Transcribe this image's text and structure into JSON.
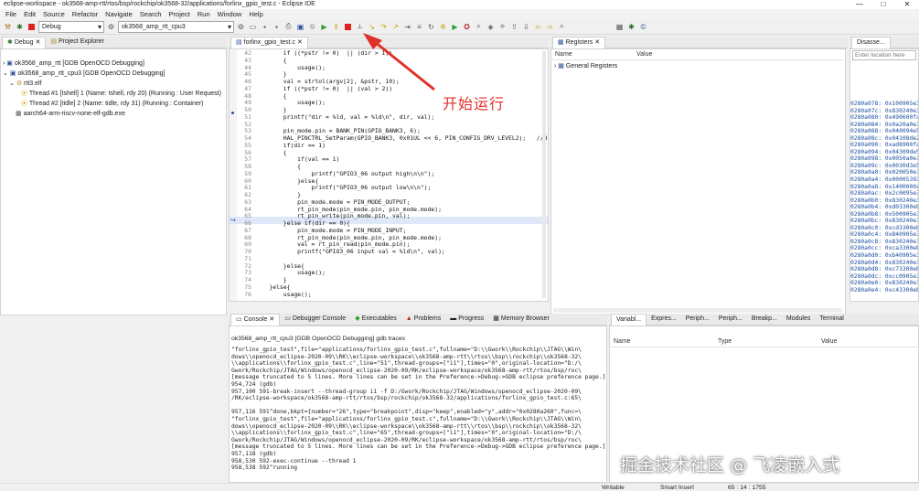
{
  "window": {
    "title": "eclipse-workspace - ok3568-amp-rtt/rtos/bsp/rockchip/ok3568-32/applications/forlinx_gpio_test.c - Eclipse IDE",
    "min": "—",
    "max": "□",
    "close": "✕"
  },
  "menu": [
    "File",
    "Edit",
    "Source",
    "Refactor",
    "Navigate",
    "Search",
    "Project",
    "Run",
    "Window",
    "Help"
  ],
  "toolbar": {
    "launch_mode": "Debug",
    "launch_config": "ok3568_amp_rtt_cpu3"
  },
  "debug_view": {
    "tabs": [
      "Debug",
      "Project Explorer"
    ],
    "tree": [
      "ok3568_amp_rtt [GDB OpenOCD Debugging]",
      "ok3568_amp_rtt_cpu3 [GDB OpenOCD Debugging]",
      "rtt3.elf",
      "Thread #1 [tshell] 1 (Name: tshell, rdy 20) (Running : User Request)",
      "Thread #2 [tidle] 2 (Name: tidle, rdy 31) (Running : Container)",
      "aarch64-arm-riscv-none-elf-gdb.exe"
    ]
  },
  "editor": {
    "tab": "forlinx_gpio_test.c",
    "line_numbers": [
      "42",
      "43",
      "44",
      "45",
      "46",
      "47",
      "48",
      "49",
      "50",
      "51",
      "52",
      "53",
      "54",
      "55",
      "56",
      "57",
      "58",
      "59",
      "60",
      "61",
      "62",
      "63",
      "64",
      "65",
      "66",
      "67",
      "68",
      "69",
      "70",
      "71",
      "72",
      "73",
      "74",
      "75",
      "76"
    ],
    "lines": [
      "        if ((*pstr != 0)  || (dir > 1))",
      "        {",
      "            usage();",
      "        }",
      "        val = strtol(argv[2], &pstr, 10);",
      "        if ((*pstr != 0)  || (val > 2))",
      "        {",
      "            usage();",
      "        }",
      "        printf(\"dir = %ld, val = %ld\\n\", dir, val);",
      "",
      "        pin_mode.pin = BANK_PIN(GPIO_BANK3, 6);",
      "        HAL_PINCTRL_SetParam(GPIO_BANK3, 0x01UL << 6, PIN_CONFIG_DRV_LEVEL2);   //d",
      "        if(dir == 1)",
      "        {",
      "            if(val == 1)",
      "            {",
      "                printf(\"GPIO3_06 output high\\n\\n\");",
      "            }else{",
      "                printf(\"GPIO3_06 output low\\n\\n\");",
      "            }",
      "            pin_mode.mode = PIN_MODE_OUTPUT;",
      "            rt_pin_mode(pin_mode.pin, pin_mode.mode);",
      "            rt_pin_write(pin_mode.pin, val);",
      "        }else if(dir == 0){",
      "            pin_mode.mode = PIN_MODE_INPUT;",
      "            rt_pin_mode(pin_mode.pin, pin_mode.mode);",
      "            val = rt_pin_read(pin_mode.pin);",
      "            printf(\"GPIO3_06 input val = %ld\\n\", val);",
      "",
      "        }else{",
      "            usage();",
      "        }",
      "    }else{",
      "        usage();"
    ]
  },
  "registers": {
    "tabs": [
      "Registers"
    ],
    "col_name": "Name",
    "col_value": "Value",
    "row": "General Registers"
  },
  "disassembly": {
    "tab": "Disasse...",
    "placeholder": "Enter location here",
    "lines": [
      "0280a078: 0x100905e3",
      "0280a07c: 0x830240e3",
      "0280a080: 0x490600fa",
      "0280a084: 0x0a20a0e3",
      "0280a088: 0x040094e5",
      "0280a08c: 0x04108de2",
      "0280a090: 0xad8900fa",
      "0280a094: 0x04309de5",
      "0280a098: 0x0050a0e1",
      "0280a09c: 0x0030d3e5",
      "0280a0a0: 0x020050e3",
      "0280a0a4: 0x00005393",
      "0280a0a8: 0x1400000a",
      "0280a0ac: 0x2c0095e3",
      "0280a0b0: 0x830240e3",
      "0280a0b4: 0xd03300eb",
      "0280a0b8: 0x500905e3",
      "0280a0bc: 0x830240e3",
      "0280a0c0: 0xcd3300eb",
      "0280a0c4: 0x840905e3",
      "0280a0c8: 0x830240e3",
      "0280a0cc: 0xca3300eb",
      "0280a0d0: 0xb40905e3",
      "0280a0d4: 0x830240e3",
      "0280a0d8: 0xc73300eb",
      "0280a0dc: 0xcc0905e3",
      "0280a0e0: 0x830240e3",
      "0280a0e4: 0xc43300eb"
    ]
  },
  "console": {
    "tabs": [
      "Console",
      "Debugger Console",
      "Executables",
      "Problems",
      "Progress",
      "Memory Browser"
    ],
    "header": "ok3568_amp_rtt_cpu3 [GDB OpenOCD Debugging] gdb traces",
    "lines": [
      "\"forlinx_gpio_test\",file=\"applications/forlinx_gpio_test.c\",fullname=\"D:\\\\Gwork\\\\Rockchip\\\\JTAG\\\\Win\\",
      "dows\\\\openocd_eclipse-2020-09\\\\RK\\\\eclipse-workspace\\\\ok3568-amp-rtt\\\\rtos\\\\bsp\\\\rockchip\\\\ok3568-32\\",
      "\\\\applications\\\\forlinx_gpio_test.c\",line=\"51\",thread-groups=[\"i1\"],times=\"0\",original-location=\"D:/\\",
      "Gwork/Rockchip/JTAG/Windows/openocd_eclipse-2020-09/RK/eclipse-workspace/ok3568-amp-rtt/rtos/bsp/roc\\",
      "[message truncated to 5 lines. More lines can be set in the Preference->Debug->GDB eclipse preference page.]",
      "954,724 (gdb)",
      "957,100 591-break-insert --thread-group i1 -f D:/Gwork/Rockchip/JTAG/Windows/openocd_eclipse-2020-09\\",
      "/RK/eclipse-workspace/ok3568-amp-rtt/rtos/bsp/rockchip/ok3568-32/applications/forlinx_gpio_test.c:65\\",
      "",
      "957,116 591^done,bkpt={number=\"26\",type=\"breakpoint\",disp=\"keep\",enabled=\"y\",addr=\"0x0280a260\",func=\\",
      "\"forlinx_gpio_test\",file=\"applications/forlinx_gpio_test.c\",fullname=\"D:\\\\Gwork\\\\Rockchip\\\\JTAG\\\\Win\\",
      "dows\\\\openocd_eclipse-2020-09\\\\RK\\\\eclipse-workspace\\\\ok3568-amp-rtt\\\\rtos\\\\bsp\\\\rockchip\\\\ok3568-32\\",
      "\\\\applications\\\\forlinx_gpio_test.c\",line=\"65\",thread-groups=[\"i1\"],times=\"0\",original-location=\"D:/\\",
      "Gwork/Rockchip/JTAG/Windows/openocd_eclipse-2020-09/RK/eclipse-workspace/ok3568-amp-rtt/rtos/bsp/roc\\",
      "[message truncated to 5 lines. More lines can be set in the Preference->Debug->GDB eclipse preference page.]",
      "957,118 (gdb)",
      "958,530 592-exec-continue --thread 1",
      "958,538 592^running"
    ]
  },
  "variables": {
    "tabs": [
      "Variabl...",
      "Expres...",
      "Periph...",
      "Periph...",
      "Breakp...",
      "Modules",
      "Terminal"
    ],
    "col_name": "Name",
    "col_type": "Type",
    "col_value": "Value"
  },
  "status": {
    "writable": "Writable",
    "insert": "Smart Insert",
    "position": "65 : 14 : 1755"
  },
  "annotation": {
    "text": "开始运行",
    "color": "#e0302a"
  },
  "watermark": {
    "text": "掘金技术社区 @ 飞凌嵌入式"
  }
}
